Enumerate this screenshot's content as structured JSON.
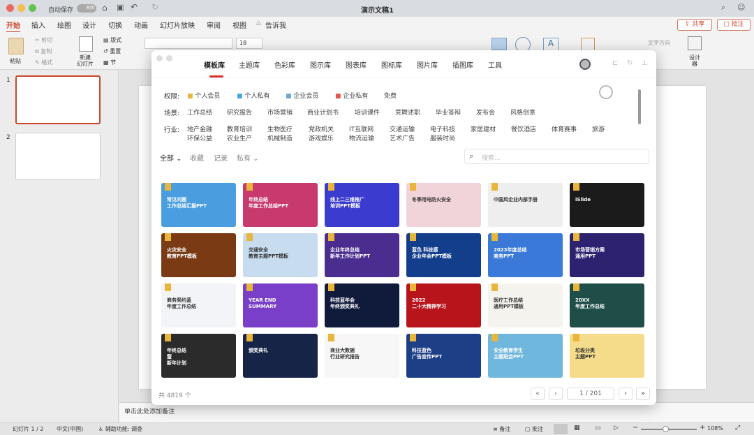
{
  "titlebar": {
    "autosave": "自动保存",
    "toggle": "关闭",
    "doc_title": "演示文稿1"
  },
  "ribbon_tabs": [
    "开始",
    "插入",
    "绘图",
    "设计",
    "切换",
    "动画",
    "幻灯片放映",
    "审阅",
    "视图"
  ],
  "tell_me": "告诉我",
  "share": "共享",
  "comments": "批注",
  "ribbon": {
    "paste": "粘贴",
    "cut": "剪切",
    "copy": "复制",
    "format": "格式",
    "new_slide": "新建\n幻灯片",
    "layout": "版式",
    "reset": "重置",
    "section": "节",
    "font_size": "18",
    "text_direction": "文字方向",
    "design_ideas": "设计\n器"
  },
  "slides": [
    "1",
    "2"
  ],
  "notes_placeholder": "单击此处添加备注",
  "status": {
    "slide": "幻灯片 1 / 2",
    "lang": "中文(中国)",
    "accessibility": "辅助功能: 调查",
    "notes": "备注",
    "comments": "批注",
    "zoom": "108%"
  },
  "dialog": {
    "tabs": [
      "模板库",
      "主题库",
      "色彩库",
      "图示库",
      "图表库",
      "图标库",
      "图片库",
      "插图库",
      "工具"
    ],
    "active_tab": "模板库",
    "filters": {
      "rights_label": "权限:",
      "rights": [
        "个人会员",
        "个人私有",
        "企业会员",
        "企业私有",
        "免费"
      ],
      "scene_label": "场景:",
      "scene": [
        "工作总结",
        "研究报告",
        "市场营销",
        "商业计划书",
        "培训课件",
        "竞聘述职",
        "毕业答辩",
        "发布会",
        "风格创意"
      ],
      "industry_label": "行业:",
      "industry": [
        "地产金融",
        "教育培训",
        "生物医疗",
        "党政机关",
        "IT互联网",
        "交通运输",
        "电子科技",
        "家居建材",
        "餐饮酒店",
        "体育赛事",
        "旅游",
        "环保公益",
        "农业生产",
        "机械制造",
        "游戏娱乐",
        "物流运输",
        "艺术广告",
        "服装时尚"
      ]
    },
    "subtabs": [
      "全部",
      "收藏",
      "记录",
      "私有"
    ],
    "search_placeholder": "搜索...",
    "cards": [
      {
        "title": "常见问题\n工作总结汇报PPT",
        "bg": "#4a9ee0"
      },
      {
        "title": "年终总结\n年度工作总结PPT",
        "bg": "#c83a6e"
      },
      {
        "title": "线上二三维推广\n培训PPT模板",
        "bg": "#3b3bcf"
      },
      {
        "title": "冬季用电防火安全",
        "bg": "#f0d4da"
      },
      {
        "title": "中国风企业内部手册",
        "bg": "#eeeeee"
      },
      {
        "title": "iSlide",
        "bg": "#1b1b1b"
      },
      {
        "title": "火灾安全\n教育PPT模板",
        "bg": "#7a3b14"
      },
      {
        "title": "交通安全\n教育主题PPT模板",
        "bg": "#c7dcef"
      },
      {
        "title": "企业年终总结\n新年工作计划PPT",
        "bg": "#4a2d8f"
      },
      {
        "title": "蓝色 科技感\n企业年会PPT模板",
        "bg": "#123e8c"
      },
      {
        "title": "2023年度总结\n商务PPT",
        "bg": "#3a79d8"
      },
      {
        "title": "市场营销方案\n通用PPT",
        "bg": "#2c2270"
      },
      {
        "title": "商务简约蓝\n年度工作总结",
        "bg": "#f2f4f8"
      },
      {
        "title": "YEAR END\nSUMMARY",
        "bg": "#7a3fc8"
      },
      {
        "title": "科技蓝年会\n年终颁奖典礼",
        "bg": "#101a3b"
      },
      {
        "title": "2022\n二十大精神学习",
        "bg": "#b8141c"
      },
      {
        "title": "医疗工作总结\n通用PPT模板",
        "bg": "#f5f3ee"
      },
      {
        "title": "20XX\n年度工作总结",
        "bg": "#1f4d48"
      },
      {
        "title": "年终总结\n暨\n新年计划",
        "bg": "#2b2b2b"
      },
      {
        "title": "颁奖典礼",
        "bg": "#152447"
      },
      {
        "title": "商业大数据\n行业研究报告",
        "bg": "#f7f7f7"
      },
      {
        "title": "科技蓝色\n广告宣传PPT",
        "bg": "#1d3f86"
      },
      {
        "title": "安全教育学生\n主题班会PPT",
        "bg": "#6fb7dc"
      },
      {
        "title": "垃圾分类\n主题PPT",
        "bg": "#f4dc8a"
      }
    ],
    "total": "共 4819 个",
    "page": "1 / 201"
  },
  "colors": {
    "accent": "#c9472b",
    "tag_gold": "#e9b53a"
  }
}
